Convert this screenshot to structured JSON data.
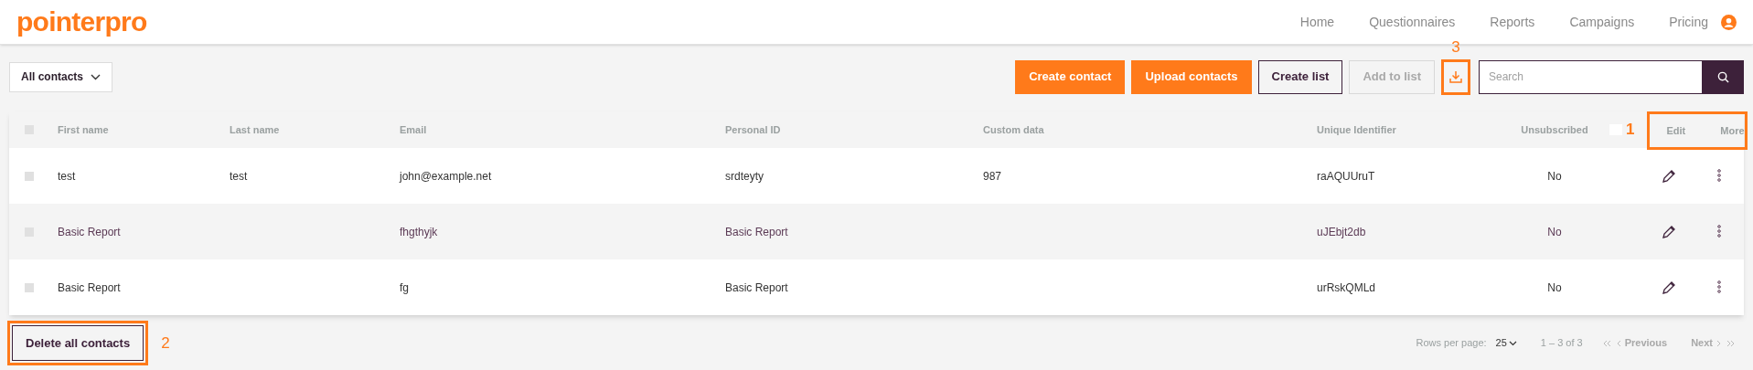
{
  "logo": "pointerpro",
  "nav": [
    {
      "label": "Home"
    },
    {
      "label": "Questionnaires"
    },
    {
      "label": "Reports"
    },
    {
      "label": "Campaigns"
    },
    {
      "label": "Pricing"
    }
  ],
  "list_filter": {
    "value": "All contacts"
  },
  "toolbar": {
    "buttons": [
      {
        "label": "Create contact",
        "kind": "primary",
        "disabled": false
      },
      {
        "label": "Upload contacts",
        "kind": "primary",
        "disabled": false
      },
      {
        "label": "Create list",
        "kind": "outline",
        "disabled": false
      },
      {
        "label": "Add to list",
        "kind": "outline",
        "disabled": true
      }
    ],
    "search": {
      "placeholder": "Search"
    }
  },
  "table": {
    "select_all": {
      "checked": false
    },
    "columns": [
      "First name",
      "Last name",
      "Email",
      "Personal ID",
      "Custom data",
      "Unique Identifier",
      "Unsubscribed",
      "Edit",
      "More"
    ],
    "rows": [
      {
        "checked": false,
        "highlighted": false,
        "cells": [
          "test",
          "test",
          "john@example.net",
          "srdteyty",
          "987",
          "raAQUUruT",
          "No"
        ]
      },
      {
        "checked": false,
        "highlighted": true,
        "cells": [
          "Basic Report",
          "",
          "fhgthyjk",
          "Basic Report",
          "",
          "uJEbjt2db",
          "No"
        ]
      },
      {
        "checked": false,
        "highlighted": false,
        "cells": [
          "Basic Report",
          "",
          "fg",
          "Basic Report",
          "",
          "urRskQMLd",
          "No"
        ]
      }
    ]
  },
  "delete_button": "Delete all contacts",
  "pagination": {
    "rows_per_page_label": "Rows per page:",
    "rows_per_page": "25",
    "range": "1 – 3 of 3",
    "previous": "Previous",
    "next": "Next"
  },
  "annotations": [
    {
      "label": "1"
    },
    {
      "label": "2"
    },
    {
      "label": "3"
    }
  ]
}
